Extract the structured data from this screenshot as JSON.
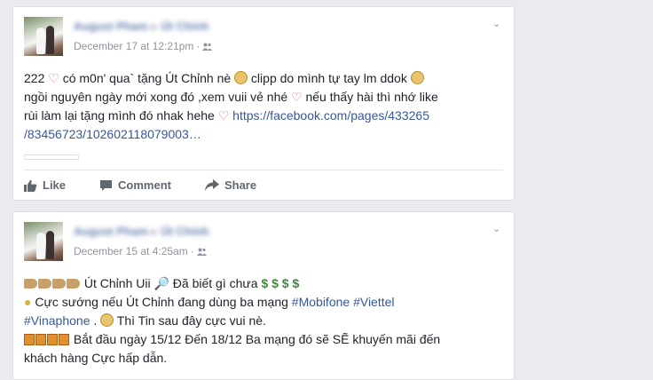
{
  "post1": {
    "author": "August Pham",
    "target": "Út Chỉnh",
    "time": "December 17 at 12:21pm",
    "text_a": "222 ",
    "text_b": " có m0n' qua` tặng Út Chỉnh nè ",
    "text_c": " clipp do mình tự tay lm ddok ",
    "text_d": "ngồi nguyên ngày mới xong đó ,xem vuii vẻ nhé ",
    "text_e": " nếu thấy hài thì nhớ like",
    "text_f": "rùi làm lại tặng mình đó nhak hehe ",
    "link_a": "https://facebook.com/pages/433265",
    "link_b": "/83456723/102602118079003…",
    "actions": {
      "like": "Like",
      "comment": "Comment",
      "share": "Share"
    }
  },
  "post2": {
    "author": "August Pham",
    "target": "Út Chỉnh",
    "time": "December 15 at 4:25am",
    "l1_text": " Út Chỉnh Uii ",
    "l1_text2": " Đã biết gì chưa ",
    "money": "$ $ $ $",
    "l2_text": " Cực sướng nếu Út Chỉnh đang dùng ba mạng ",
    "tag_mobifone": "#Mobifone",
    "tag_viettel": "#Viettel",
    "tag_vinaphone": "#Vinaphone",
    "l3_text": " . ",
    "l3_text2": " Thì Tin sau đây cực vui nè.",
    "l4_text": " Bắt đầu ngày 15/12 Đến 18/12 Ba mạng đó sẽ SẼ khuyến mãi đến",
    "l5_text": "khách hàng Cực hấp dẫn."
  },
  "colors": {
    "link": "#365899",
    "meta": "#90949c",
    "background": "#e9ebee"
  }
}
